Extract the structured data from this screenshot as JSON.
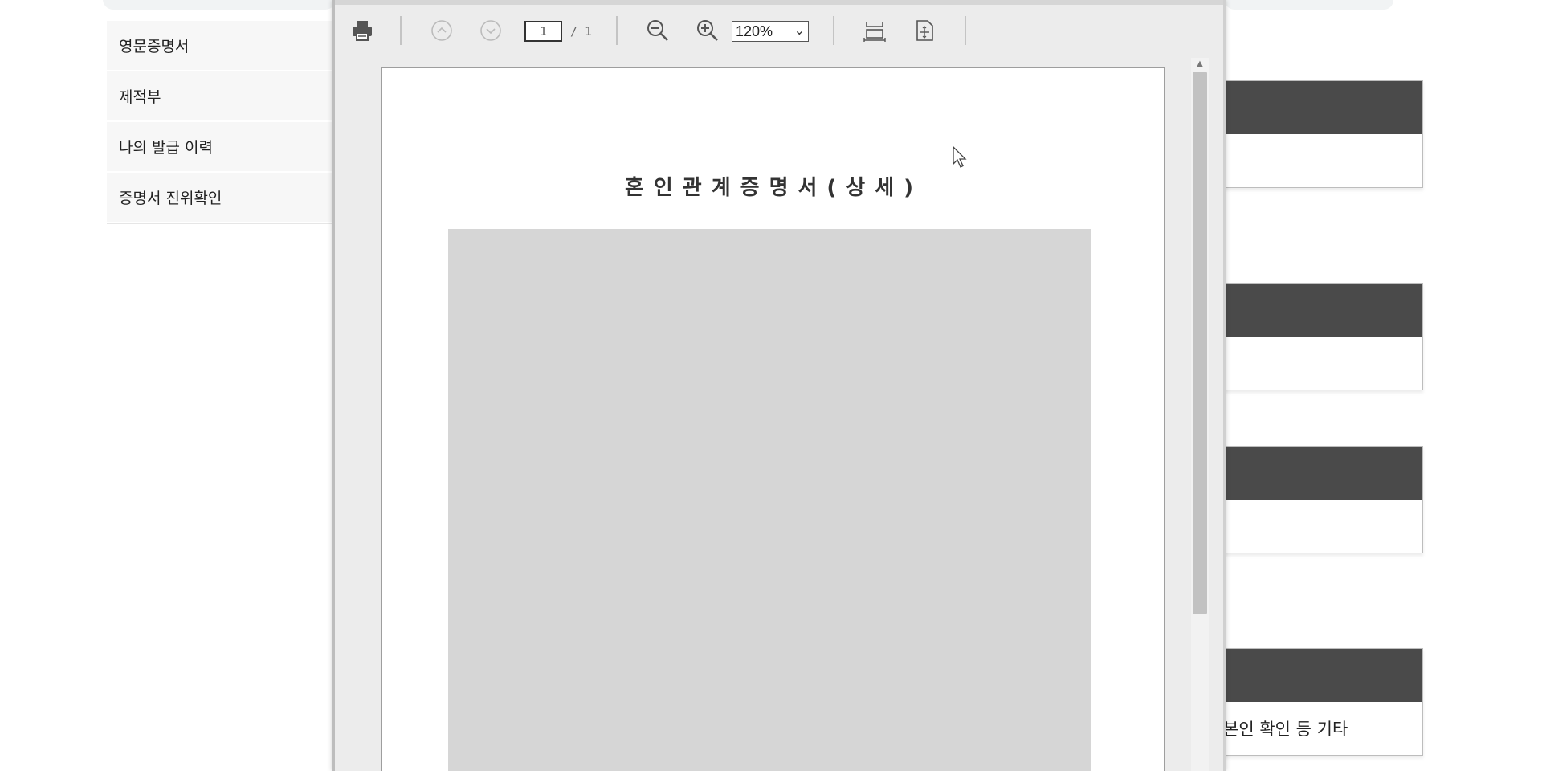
{
  "side_menu": {
    "items": [
      {
        "label": "영문증명서"
      },
      {
        "label": "제적부"
      },
      {
        "label": "나의 발급 이력"
      },
      {
        "label": "증명서 진위확인"
      }
    ]
  },
  "viewer": {
    "toolbar": {
      "page_current": "1",
      "page_total": "/ 1",
      "zoom": "120%",
      "icons": [
        "printer-icon",
        "prev-page-icon",
        "next-page-icon",
        "zoom-out-icon",
        "zoom-in-icon",
        "fit-width-icon",
        "fit-page-icon"
      ]
    },
    "document": {
      "title": "혼인관계증명서(상세)"
    }
  },
  "right_cards": {
    "last_card_label": "본인 확인 등 기타",
    "header_color": "#4a4a4a"
  }
}
